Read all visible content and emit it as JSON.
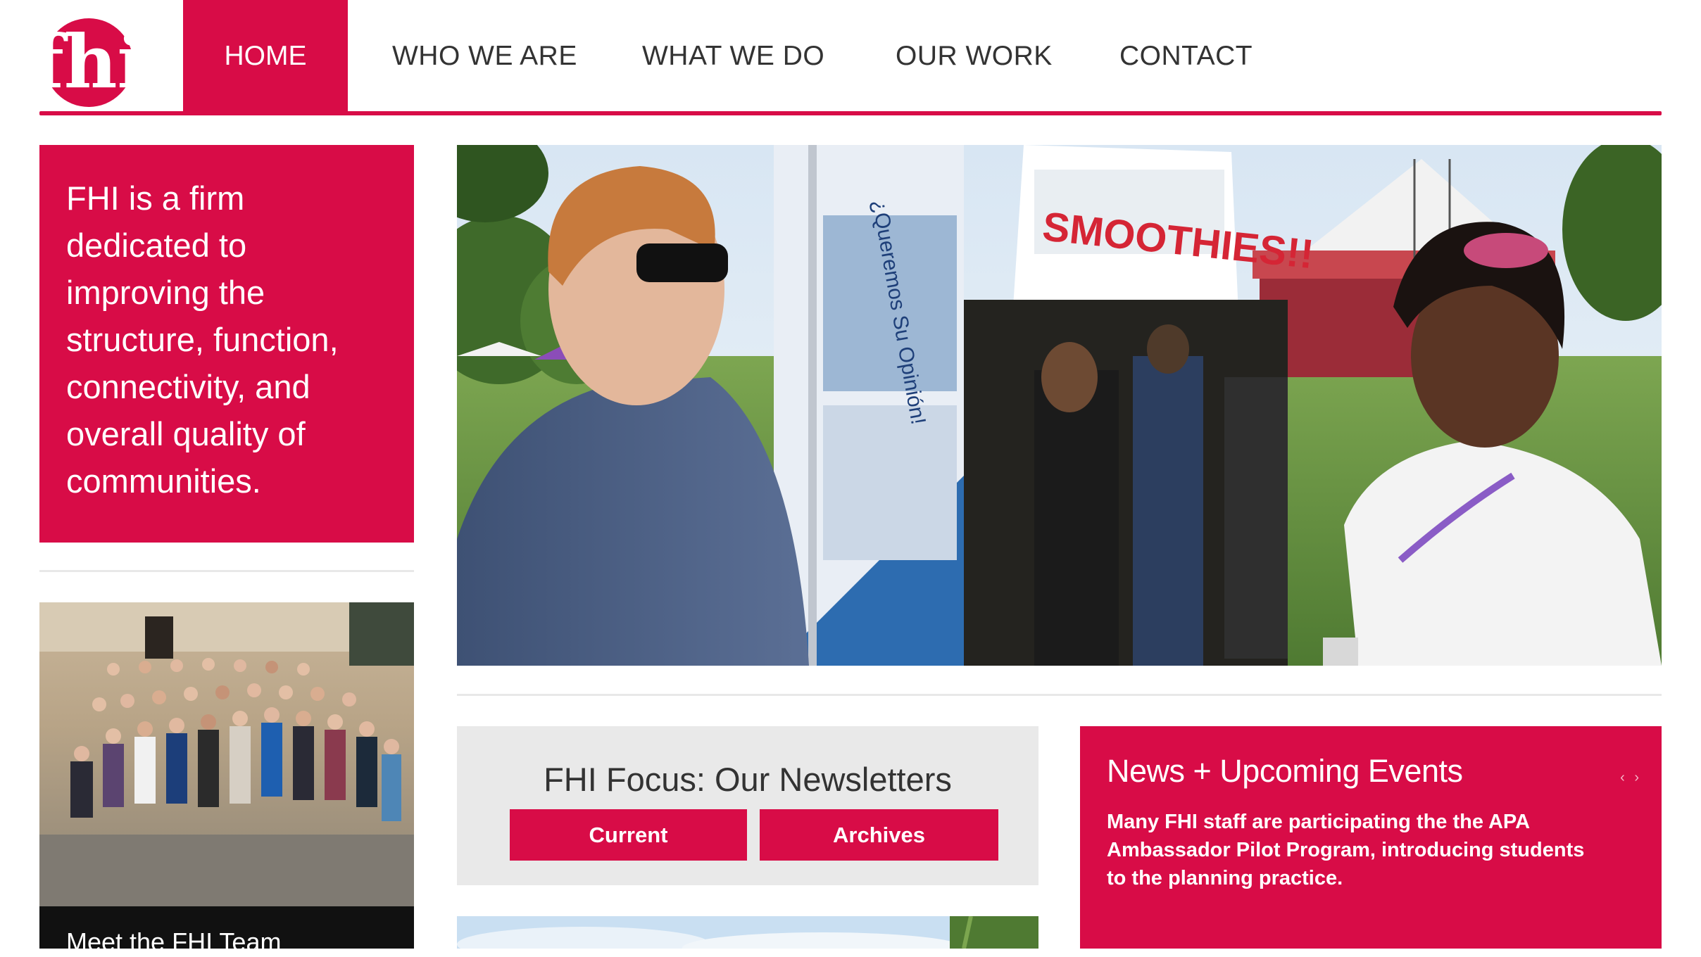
{
  "header": {
    "logo_alt": "fhi",
    "nav": [
      {
        "label": "HOME",
        "active": true
      },
      {
        "label": "WHO WE ARE"
      },
      {
        "label": "WHAT WE DO"
      },
      {
        "label": "OUR WORK"
      },
      {
        "label": "CONTACT"
      }
    ]
  },
  "tagline": "FHI is a firm dedicated to improving the structure, function, connectivity, and overall quality of communities.",
  "team": {
    "caption": "Meet the FHI Team"
  },
  "hero": {
    "banner_text": "SMOOTHIES!!",
    "sign_text": "¿Queremos Su Opinión!"
  },
  "newsletter": {
    "title": "FHI Focus: Our Newsletters",
    "current_label": "Current",
    "archives_label": "Archives"
  },
  "news": {
    "title": "News + Upcoming Events",
    "arrows": "‹ ›",
    "text": "Many FHI staff are participating the the APA Ambassador Pilot Program, introducing students to the planning practice."
  },
  "colors": {
    "brand": "#d80c47",
    "panel": "#e9e9e9"
  }
}
